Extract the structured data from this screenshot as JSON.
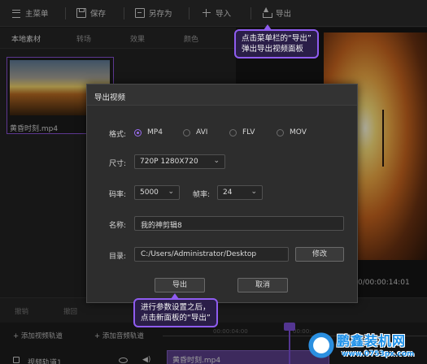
{
  "menubar": {
    "menu_label": "主菜单",
    "save_label": "保存",
    "saveas_label": "另存为",
    "import_label": "导入",
    "export_label": "导出"
  },
  "left_panel": {
    "tabs": [
      {
        "label": "本地素材"
      },
      {
        "label": "转场"
      },
      {
        "label": "效果"
      },
      {
        "label": "颜色"
      }
    ],
    "media": [
      {
        "name": "黄昏时刻.mp4"
      }
    ]
  },
  "preview": {
    "timecode": "0/00:00:14:01"
  },
  "timeline": {
    "tools": [
      "撤销",
      "撤回"
    ],
    "add_video_track": "+ 添加视频轨道",
    "add_audio_track": "+ 添加音频轨道",
    "ruler_labels": [
      "00:00:04:00",
      "00:00:"
    ],
    "track_label": "视频轨道1",
    "clip_name": "黄昏时刻.mp4"
  },
  "dialog": {
    "title": "导出视频",
    "format_label": "格式:",
    "formats": [
      "MP4",
      "AVI",
      "FLV",
      "MOV"
    ],
    "selected_format": "MP4",
    "size_label": "尺寸:",
    "size_value": "720P 1280X720",
    "bitrate_label": "码率:",
    "bitrate_value": "5000",
    "fps_label": "帧率:",
    "fps_value": "24",
    "name_label": "名称:",
    "name_value": "我的神剪辑8",
    "dir_label": "目录:",
    "dir_value": "C:/Users/Administrator/Desktop",
    "modify_button": "修改",
    "export_button": "导出",
    "cancel_button": "取消"
  },
  "callouts": {
    "top_line1": "点击菜单栏的“导出”",
    "top_line2": "弹出导出视频面板",
    "bottom_line1": "进行参数设置之后，",
    "bottom_line2": "点击新面板的“导出”"
  },
  "watermark": {
    "title": "鹏鑫装机网",
    "url": "www.0753px.com"
  },
  "colors": {
    "accent": "#8f5cf0",
    "dialog_bg": "#2d2d2d",
    "app_bg": "#1e1e1e"
  }
}
